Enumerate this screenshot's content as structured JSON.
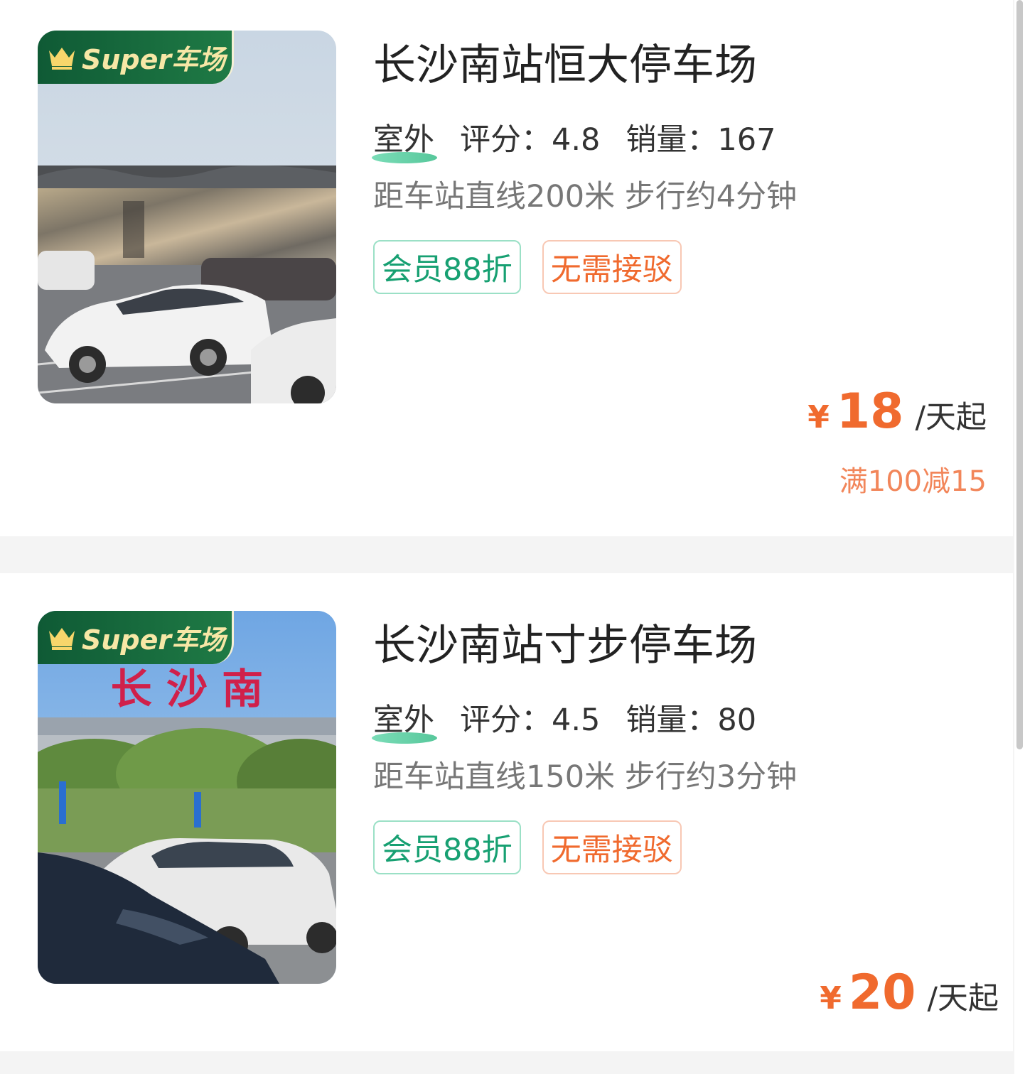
{
  "lots": [
    {
      "badge": "Super车场",
      "name": "长沙南站恒大停车场",
      "environment": "室外",
      "rating": "评分：4.8",
      "sales": "销量：167",
      "distance": "距车站直线200米 步行约4分钟",
      "tags": [
        "会员88折",
        "无需接驳"
      ],
      "currency": "¥",
      "price": "18",
      "price_unit": "/天起",
      "promo": "满100减15"
    },
    {
      "badge": "Super车场",
      "name": "长沙南站寸步停车场",
      "environment": "室外",
      "rating": "评分：4.5",
      "sales": "销量：80",
      "distance": "距车站直线150米 步行约3分钟",
      "tags": [
        "会员88折",
        "无需接驳"
      ],
      "currency": "¥",
      "price": "20",
      "price_unit": "/天起",
      "photo_sign_text": "长 沙 南"
    }
  ],
  "colors": {
    "accent_orange": "#f06a2e",
    "member_green": "#17a072",
    "badge_green": "#1f7a45"
  }
}
